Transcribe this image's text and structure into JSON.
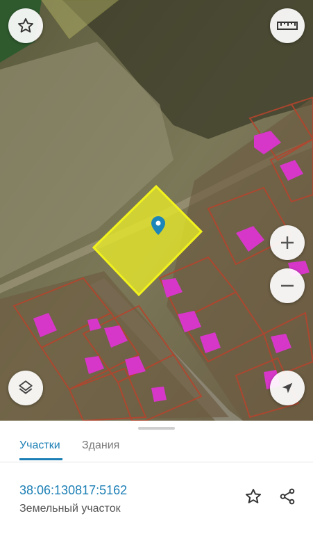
{
  "map": {
    "favorite_icon": "star-outline-icon",
    "ruler_icon": "ruler-icon",
    "zoom_in_icon": "plus-icon",
    "zoom_out_icon": "minus-icon",
    "layers_icon": "layers-icon",
    "location_icon": "navigation-arrow-icon",
    "pin_icon": "map-pin-icon",
    "colors": {
      "selected_parcel": "#e9ea2a",
      "parcel_border": "#b3452e",
      "building": "#d637c8",
      "pin": "#1c86b8"
    }
  },
  "tabs": [
    {
      "label": "Участки",
      "active": true
    },
    {
      "label": "Здания",
      "active": false
    }
  ],
  "parcel": {
    "cadastral_number": "38:06:130817:5162",
    "type": "Земельный участок"
  },
  "actions": {
    "favorite_icon": "star-outline-icon",
    "share_icon": "share-icon"
  },
  "accent_color": "#1b7fb5"
}
